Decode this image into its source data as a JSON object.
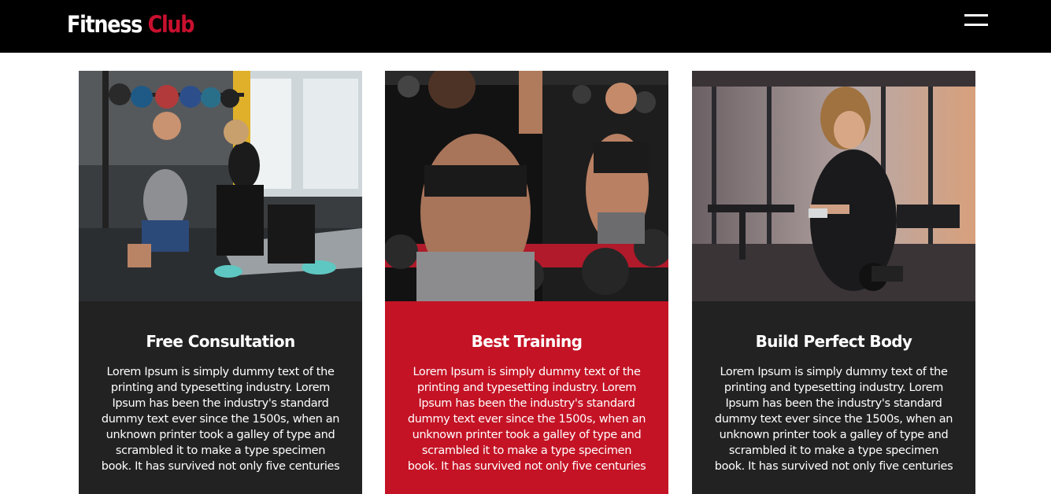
{
  "header": {
    "logo_first": "Fitness",
    "logo_second": "Club",
    "menu_icon": "hamburger-menu-icon"
  },
  "colors": {
    "header_bg": "#000000",
    "accent": "#c8102e",
    "dark_panel": "#222222",
    "red_panel": "#c41325"
  },
  "cards": [
    {
      "title": "Free Consultation",
      "text": "Lorem Ipsum is simply dummy text of the printing and typesetting industry. Lorem Ipsum has been the industry's standard dummy text ever since the 1500s, when an unknown printer took a galley of type and scrambled it to make a type specimen book. It has survived not only five centuries"
    },
    {
      "title": "Best Training",
      "text": "Lorem Ipsum is simply dummy text of the printing and typesetting industry. Lorem Ipsum has been the industry's standard dummy text ever since the 1500s, when an unknown printer took a galley of type and scrambled it to make a type specimen book. It has survived not only five centuries"
    },
    {
      "title": "Build Perfect Body",
      "text": "Lorem Ipsum is simply dummy text of the printing and typesetting industry. Lorem Ipsum has been the industry's standard dummy text ever since the 1500s, when an unknown printer took a galley of type and scrambled it to make a type specimen book. It has survived not only five centuries"
    }
  ]
}
